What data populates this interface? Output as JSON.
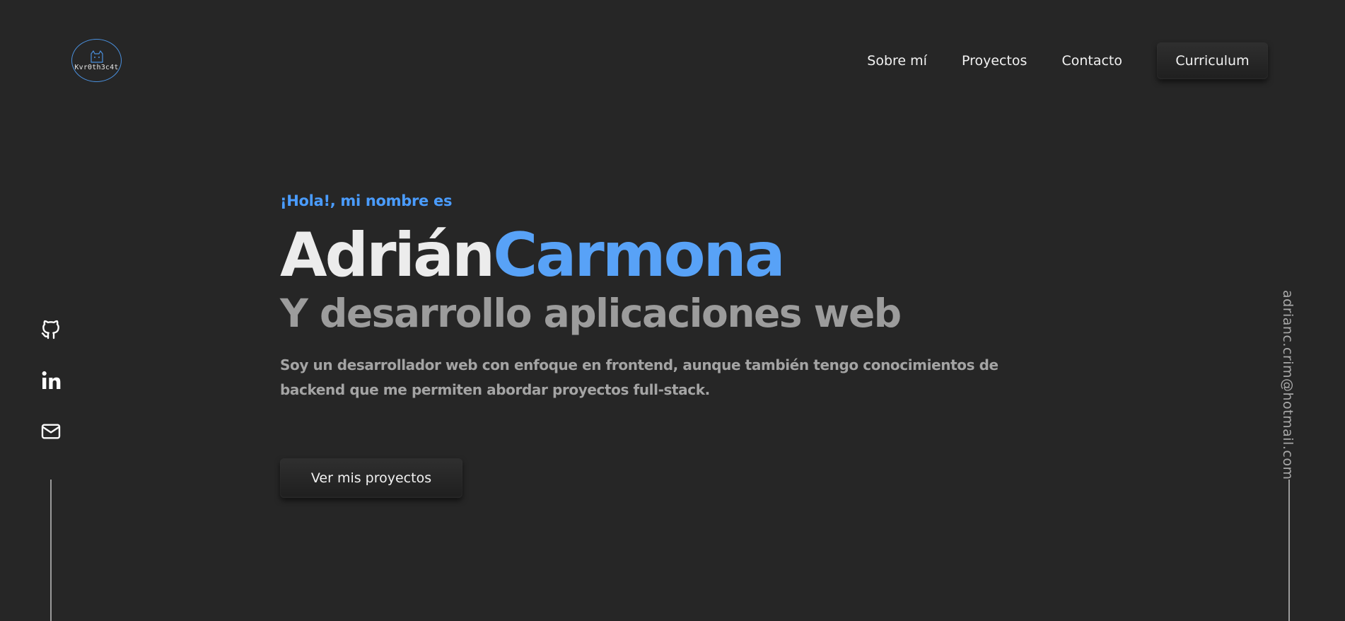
{
  "header": {
    "logo_text": "Kvr0th3c4t",
    "nav": [
      {
        "label": "Sobre mí"
      },
      {
        "label": "Proyectos"
      },
      {
        "label": "Contacto"
      }
    ],
    "cta_label": "Curriculum"
  },
  "social": [
    {
      "icon": "github-icon"
    },
    {
      "icon": "linkedin-icon"
    },
    {
      "icon": "mail-icon"
    }
  ],
  "email": "adrianc.crim@hotmail.com",
  "hero": {
    "greeting": "¡Hola!, mi nombre es",
    "first_name": "Adrián",
    "last_name": "Carmona",
    "tagline": "Y desarrollo aplicaciones web",
    "description": "Soy un desarrollador web con enfoque en frontend, aunque también tengo conocimientos de backend que me permiten abordar proyectos full-stack.",
    "cta_label": "Ver mis proyectos"
  },
  "colors": {
    "background": "#262626",
    "accent": "#4a9cff",
    "text_primary": "#ececec",
    "text_muted": "#9c9c9c"
  }
}
